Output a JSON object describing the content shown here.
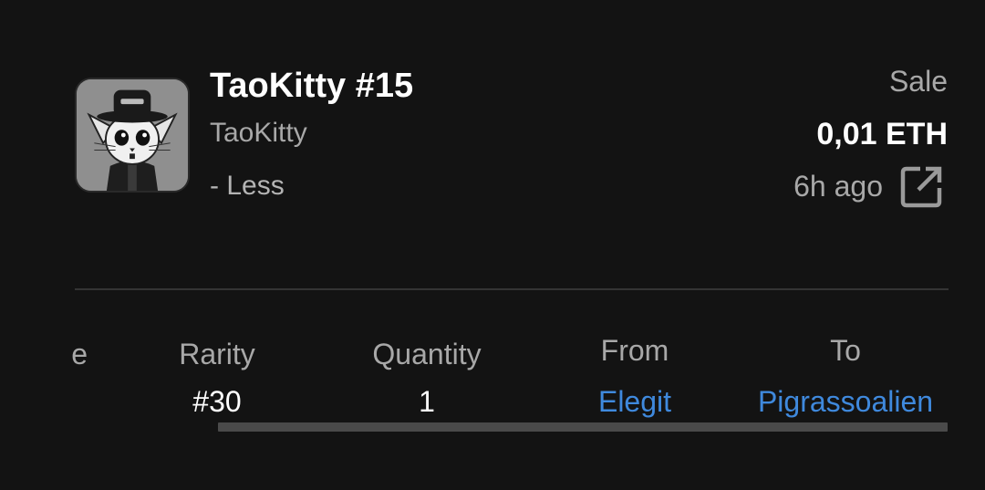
{
  "item": {
    "title": "TaoKitty #15",
    "collection": "TaoKitty",
    "toggle_label": "- Less"
  },
  "event": {
    "type": "Sale",
    "price": "0,01 ETH",
    "time_ago": "6h ago"
  },
  "details": {
    "partial_label": "e",
    "columns": [
      {
        "label": "Rarity",
        "value": "#30"
      },
      {
        "label": "Quantity",
        "value": "1"
      },
      {
        "label": "From",
        "value": "Elegit"
      },
      {
        "label": "To",
        "value": "Pigrassoalien"
      }
    ]
  },
  "colors": {
    "background": "#131313",
    "link": "#3f89dd",
    "muted": "#a8a8a8"
  },
  "icons": {
    "thumbnail": "nft-kitty-thumbnail",
    "external": "open-in-new-icon"
  }
}
